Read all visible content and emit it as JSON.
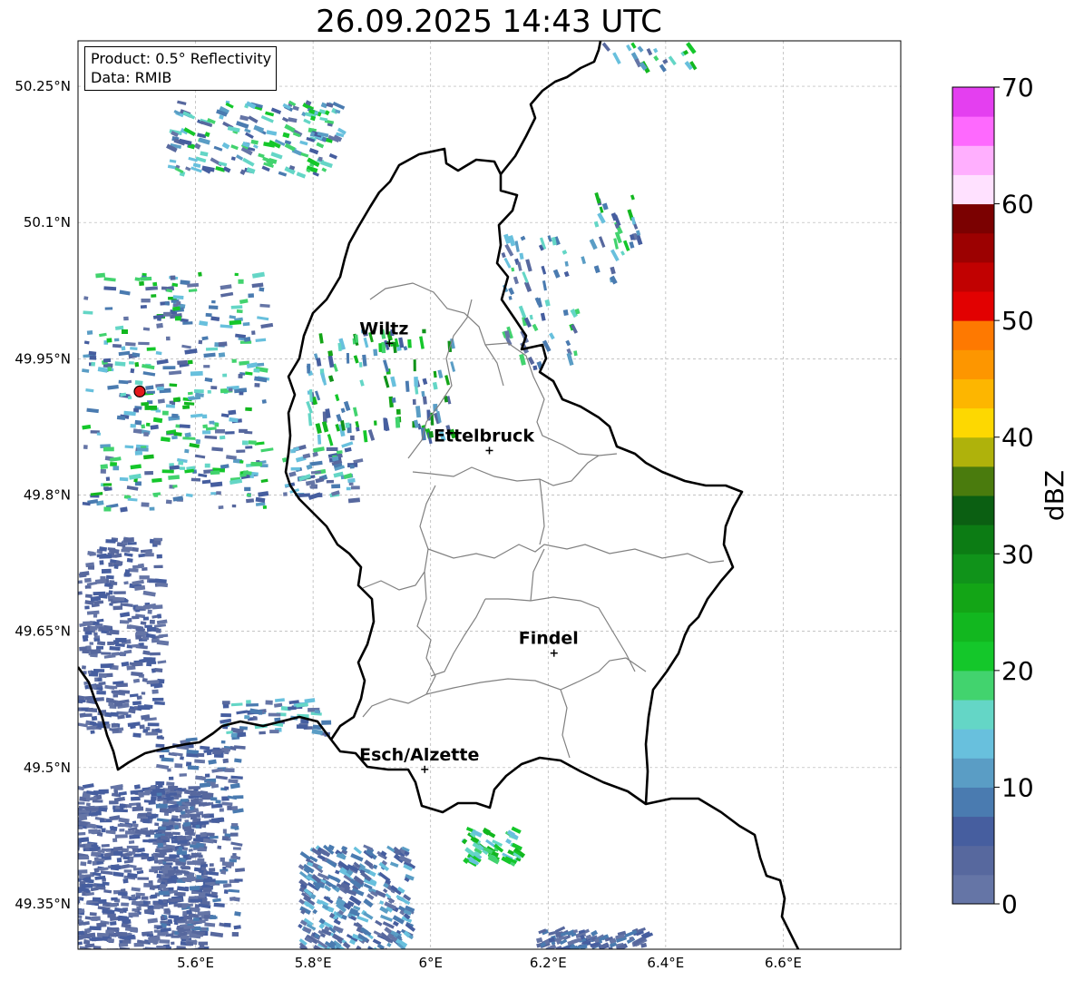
{
  "title": "26.09.2025 14:43 UTC",
  "info": {
    "product": "Product: 0.5° Reflectivity",
    "data": "Data: RMIB"
  },
  "lat_ticks": [
    {
      "value": 50.25,
      "label": "50.25°N"
    },
    {
      "value": 50.1,
      "label": "50.1°N"
    },
    {
      "value": 49.95,
      "label": "49.95°N"
    },
    {
      "value": 49.8,
      "label": "49.8°N"
    },
    {
      "value": 49.65,
      "label": "49.65°N"
    },
    {
      "value": 49.5,
      "label": "49.5°N"
    },
    {
      "value": 49.35,
      "label": "49.35°N"
    }
  ],
  "lon_ticks": [
    {
      "value": 5.6,
      "label": "5.6°E"
    },
    {
      "value": 5.8,
      "label": "5.8°E"
    },
    {
      "value": 6.0,
      "label": "6°E"
    },
    {
      "value": 6.2,
      "label": "6.2°E"
    },
    {
      "value": 6.4,
      "label": "6.4°E"
    },
    {
      "value": 6.6,
      "label": "6.6°E"
    }
  ],
  "extent": {
    "lon_min": 5.4,
    "lon_max": 6.8,
    "lat_min": 49.3,
    "lat_max": 50.3
  },
  "cities": [
    {
      "name": "Wiltz",
      "lon": 5.93,
      "lat": 49.967
    },
    {
      "name": "Ettelbruck",
      "lon": 6.1,
      "lat": 49.849
    },
    {
      "name": "Findel",
      "lon": 6.21,
      "lat": 49.626
    },
    {
      "name": "Esch/Alzette",
      "lon": 5.99,
      "lat": 49.498
    }
  ],
  "radar_site": {
    "lon": 5.505,
    "lat": 49.914,
    "color": "#e41a1c"
  },
  "colorbar": {
    "label": "dBZ",
    "min": 0,
    "max": 70,
    "step": 2.5,
    "ticks": [
      0,
      10,
      20,
      30,
      40,
      50,
      60,
      70
    ],
    "colors": [
      "#6575a6",
      "#57689e",
      "#465e9f",
      "#4a7bb0",
      "#5a9dc5",
      "#68c0dd",
      "#64d6c6",
      "#42d36e",
      "#14c72a",
      "#12b71f",
      "#13a516",
      "#10931a",
      "#0c7c14",
      "#0b5f12",
      "#4a7b0d",
      "#afb20b",
      "#fdd801",
      "#fdb600",
      "#fd9600",
      "#fe7901",
      "#e20101",
      "#c10101",
      "#9c0101",
      "#7b0101",
      "#ffe1ff",
      "#ffaffe",
      "#fe69fe",
      "#e43ff0"
    ]
  }
}
